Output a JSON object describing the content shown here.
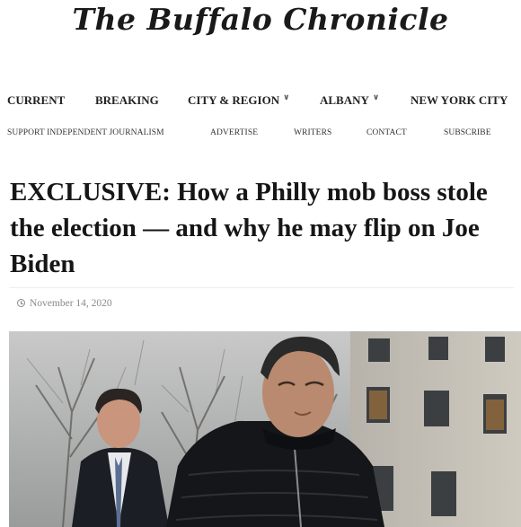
{
  "site": {
    "logo_text": "The Buffalo Chronicle"
  },
  "main_nav": {
    "current": "CURRENT",
    "breaking": "BREAKING",
    "city_region": "CITY & REGION",
    "albany": "ALBANY",
    "nyc": "NEW YORK CITY"
  },
  "sub_nav": {
    "support": "SUPPORT INDEPENDENT JOURNALISM",
    "advertise": "ADVERTISE",
    "writers": "WRITERS",
    "contact": "CONTACT",
    "subscribe": "SUBSCRIBE"
  },
  "article": {
    "headline": "EXCLUSIVE: How a Philly mob boss stole the election — and why he may flip on Joe Biden",
    "date": "November 14, 2020"
  },
  "icons": {
    "chevron": "chevron-down-icon",
    "clock": "clock-icon"
  }
}
